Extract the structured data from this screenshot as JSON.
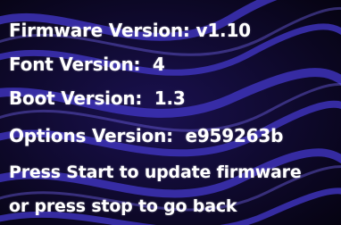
{
  "colors": {
    "background": "#05030f",
    "swirl": "#3d32b8",
    "text": "#ffffff"
  },
  "info": {
    "firmware": "Firmware Version: v1.10",
    "font": "Font Version:  4",
    "boot": "Boot Version:  1.3",
    "options": "Options Version:  e959263b"
  },
  "prompt": {
    "line1": "Press Start to update firmware",
    "line2": "or press stop to go back"
  }
}
